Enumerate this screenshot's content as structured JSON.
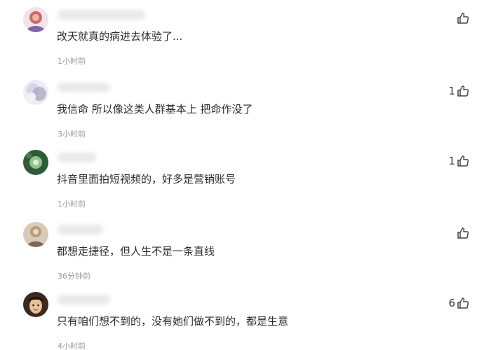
{
  "comments": [
    {
      "username": "",
      "text": "改天就真的病进去体验了...",
      "time": "1小时前",
      "likes": "",
      "avatar_colors": [
        "#c86a72",
        "#7b68a8"
      ]
    },
    {
      "username": "",
      "text": "我信命 所以像这类人群基本上 把命作没了",
      "time": "3小时前",
      "likes": "1",
      "avatar_colors": [
        "#d8d3e6",
        "#a89fbf"
      ]
    },
    {
      "username": "",
      "text": "抖音里面拍短视频的，好多是营销账号",
      "time": "1小时前",
      "likes": "1",
      "avatar_colors": [
        "#2f5a3a",
        "#8fc48a"
      ]
    },
    {
      "username": "",
      "text": "都想走捷径，但人生不是一条直线",
      "time": "36分钟前",
      "likes": "",
      "avatar_colors": [
        "#b59c7c",
        "#7c6a55"
      ]
    },
    {
      "username": "",
      "text": "只有咱们想不到的，没有她们做不到的，都是生意",
      "time": "4小时前",
      "likes": "6",
      "avatar_colors": [
        "#3a2a20",
        "#e6c39a"
      ]
    }
  ],
  "icons": {
    "like": "thumbs-up-outline-icon"
  }
}
